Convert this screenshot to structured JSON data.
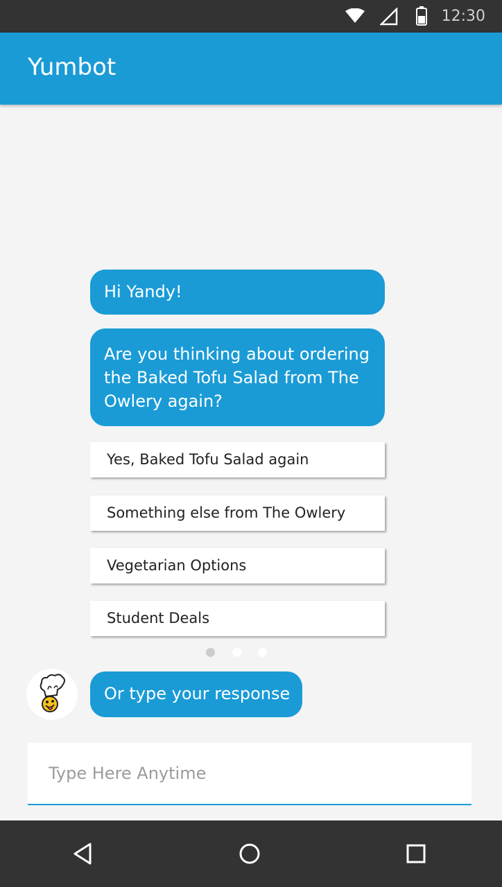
{
  "status_bar": {
    "time": "12:30",
    "icons": [
      "wifi-icon",
      "cell-signal-icon",
      "battery-icon"
    ]
  },
  "app_bar": {
    "title": "Yumbot"
  },
  "chat": {
    "messages": [
      "Hi Yandy!",
      "Are you thinking about ordering the Baked Tofu Salad from The Owlery again?"
    ],
    "quick_replies": [
      "Yes, Baked Tofu Salad again",
      "Something else from The Owlery",
      "Vegetarian Options",
      "Student Deals"
    ],
    "carousel": {
      "page_count": 3,
      "active_page": 1
    },
    "bot_prompt": "Or type your response",
    "bot_avatar_icon": "chef-emoji-icon"
  },
  "input": {
    "placeholder": "Type Here Anytime",
    "value": ""
  },
  "nav_bar": {
    "icons": [
      "back-icon",
      "home-icon",
      "recents-icon"
    ]
  },
  "colors": {
    "accent": "#1a9bd6",
    "system_bar": "#333333",
    "background": "#f4f4f4"
  }
}
